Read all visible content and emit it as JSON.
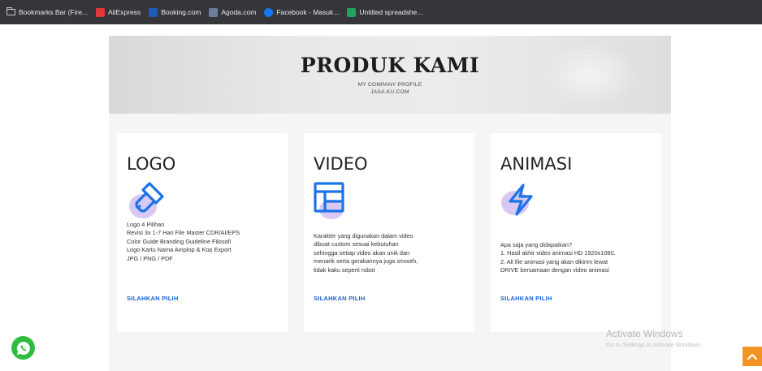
{
  "bookmarks": [
    {
      "label": "Bookmarks Bar (Fire...",
      "icon": "folder-icon",
      "color": "#c9cbcf"
    },
    {
      "label": "AliExpress",
      "icon": "aliexpress-icon",
      "color": "#e4393c"
    },
    {
      "label": "Booking.com",
      "icon": "booking-icon",
      "color": "#1e5bb8"
    },
    {
      "label": "Agoda.com",
      "icon": "agoda-icon",
      "color": "#6b7d9c"
    },
    {
      "label": "Facebook - Masuk...",
      "icon": "facebook-icon",
      "color": "#1877f2"
    },
    {
      "label": "Untitled spreadshe...",
      "icon": "sheets-icon",
      "color": "#1fa463"
    }
  ],
  "hero": {
    "title": "PRODUK KAMI",
    "subtitle1": "MY COMPANY PROFILE",
    "subtitle2": "JASA.KU.COM"
  },
  "cards": [
    {
      "title": "LOGO",
      "icon": "brush-icon",
      "lines": [
        "Logo 4 Pilihan",
        "Revisi 3x 1-7 Hari File Master CDR/AI/EPS",
        "Color Guide Branding Guideline Filosofi",
        "Logo Kartu Nama Amplop & Kop Export",
        "JPG / PNG / PDF"
      ],
      "link": "SILAHKAN PILIH"
    },
    {
      "title": "VIDEO",
      "icon": "layout-icon",
      "lines": [
        "Karakter yang digunakan dalam video",
        "dibuat custom sesuai kebutuhan",
        "sehingga setiap video akan unik dan",
        "menarik serta gerakannya juga smooth,",
        "tidak kaku seperti robot"
      ],
      "link": "SILAHKAN PILIH"
    },
    {
      "title": "ANIMASI",
      "icon": "lightning-icon",
      "lines": [
        "Apa saja yang didapatkan?",
        "1. Hasil akhir video animasi HD 1920x1080.",
        "2. All file animasi yang akan dikirim lewat",
        "DRIVE bersamaan dengan video animasi"
      ],
      "link": "SILAHKAN PILIH"
    }
  ],
  "watermark": {
    "title": "Activate Windows",
    "subtitle": "Go to Settings to activate Windows."
  },
  "colors": {
    "accent_link": "#1565d8",
    "icon_blue": "#1a73e8",
    "icon_blob": "#d9c8f3",
    "whatsapp": "#2fbd3f",
    "scroll_top": "#f39324"
  }
}
